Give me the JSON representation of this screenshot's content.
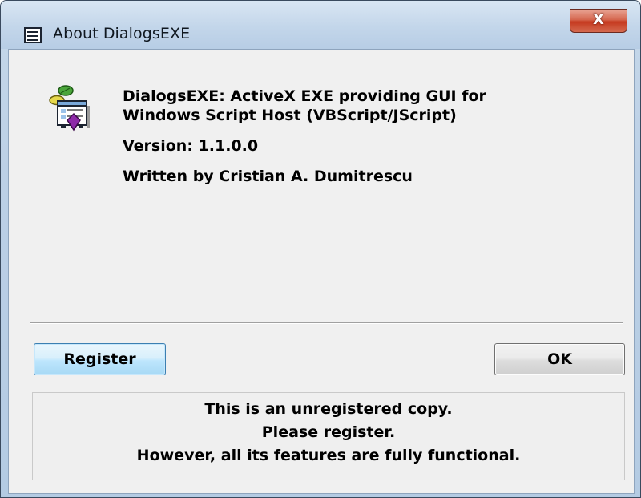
{
  "window": {
    "title": "About DialogsEXE",
    "close_label": "X"
  },
  "about": {
    "description_line1": "DialogsEXE: ActiveX EXE providing GUI for",
    "description_line2": "Windows Script Host (VBScript/JScript)",
    "version": "Version: 1.1.0.0",
    "author": "Written by Cristian A. Dumitrescu"
  },
  "buttons": {
    "register_label": "Register",
    "ok_label": "OK"
  },
  "notice": {
    "line1": "This is an unregistered copy.",
    "line2": "Please register.",
    "line3": "However, all its features are fully functional."
  },
  "icons": {
    "title_icon": "dialog-window-icon",
    "close_icon": "close-icon",
    "app_icon": "script-application-icon"
  },
  "colors": {
    "title_bar": "#c6d8ea",
    "close_button": "#c5391f",
    "dialog_background": "#f0f0f0",
    "default_button_border": "#3c7fb1"
  }
}
